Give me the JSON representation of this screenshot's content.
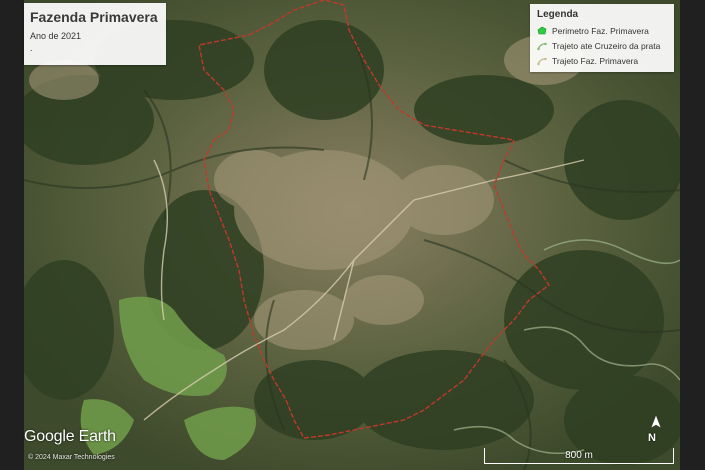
{
  "map": {
    "title": "Fazenda Primavera",
    "subtitle": "Ano de 2021",
    "note": ".",
    "legend": {
      "title": "Legenda",
      "items": [
        {
          "label": "Perimetro Faz. Primavera",
          "icon": "polygon-icon",
          "color": "#2ecc40"
        },
        {
          "label": "Trajeto ate Cruzeiro da prata",
          "icon": "path-icon",
          "color": "#7ab86a"
        },
        {
          "label": "Trajeto Faz. Primavera",
          "icon": "path-icon",
          "color": "#c8b98a"
        }
      ]
    },
    "boundary_color": "#c0392b",
    "provider_logo": "Google Earth",
    "attribution": "© 2024 Maxar Technologies",
    "scale_label": "800 m",
    "north_label": "N"
  }
}
